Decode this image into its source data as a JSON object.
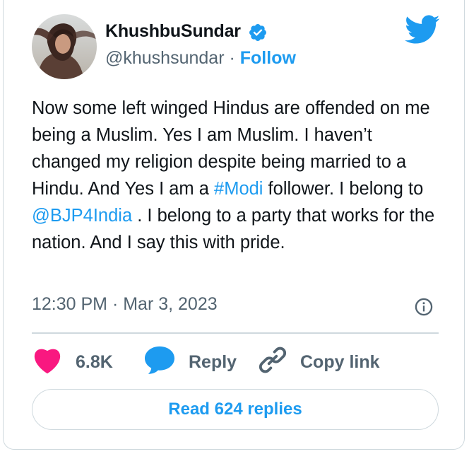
{
  "author": {
    "display_name": "KhushbuSundar",
    "handle": "@khushsundar",
    "separator": "·",
    "follow_label": "Follow"
  },
  "tweet": {
    "text_1": "Now some left winged Hindus are offended on me being a Muslim. Yes I am Muslim. I haven’t changed my religion despite being married to a Hindu. And Yes I am a ",
    "hashtag": "#Modi",
    "text_2": " follower. I belong to ",
    "mention": "@BJP4India",
    "text_3": " . I belong to a party that works for the nation. And I say this with pride.",
    "timestamp": "12:30 PM · Mar 3, 2023"
  },
  "actions": {
    "likes_count": "6.8K",
    "reply_label": "Reply",
    "copy_link_label": "Copy link"
  },
  "footer": {
    "read_replies_label": "Read 624 replies"
  },
  "colors": {
    "accent": "#1d9bf0",
    "like": "#f91880",
    "secondary_text": "#536471",
    "border": "#cfd9de"
  },
  "icons": [
    "verified-badge-icon",
    "twitter-bird-icon",
    "info-icon",
    "heart-icon",
    "reply-bubble-icon",
    "link-icon"
  ]
}
